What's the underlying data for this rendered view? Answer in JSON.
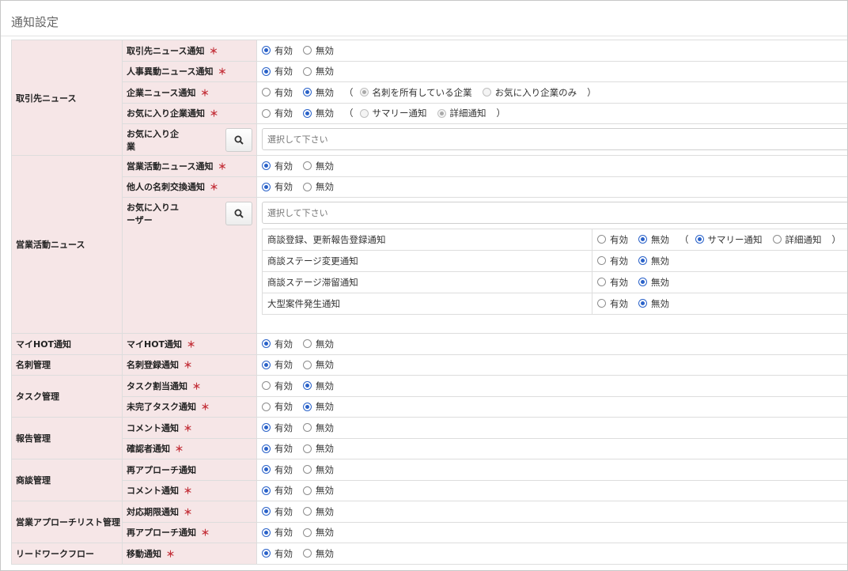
{
  "page": {
    "title": "通知設定"
  },
  "common": {
    "on": "有効",
    "off": "無効",
    "req": "＊",
    "paren_open": "（",
    "paren_close": "）",
    "picker_placeholder": "選択して下さい"
  },
  "groups": [
    {
      "category": "取引先ニュース",
      "rows": [
        {
          "label": "取引先ニュース通知",
          "required": true,
          "value": "on"
        },
        {
          "label": "人事異動ニュース通知",
          "required": true,
          "value": "on"
        },
        {
          "label": "企業ニュース通知",
          "required": true,
          "value": "off",
          "sub": [
            {
              "label": "名刺を所有している企業",
              "selected": true
            },
            {
              "label": "お気に入り企業のみ",
              "selected": false
            }
          ]
        },
        {
          "label": "お気に入り企業通知",
          "required": true,
          "value": "off",
          "sub": [
            {
              "label": "サマリー通知",
              "selected": false
            },
            {
              "label": "詳細通知",
              "selected": true
            }
          ]
        },
        {
          "label": "お気に入り企業",
          "type": "picker"
        }
      ]
    },
    {
      "category": "営業活動ニュース",
      "rows": [
        {
          "label": "営業活動ニュース通知",
          "required": true,
          "value": "on"
        },
        {
          "label": "他人の名刺交換通知",
          "required": true,
          "value": "on"
        },
        {
          "label": "お気に入りユーザー",
          "type": "picker",
          "subtable": [
            {
              "name": "商談登録、更新報告登録通知",
              "value": "off",
              "sub": [
                {
                  "label": "サマリー通知",
                  "selected": true
                },
                {
                  "label": "詳細通知",
                  "selected": false
                }
              ]
            },
            {
              "name": "商談ステージ変更通知",
              "value": "off"
            },
            {
              "name": "商談ステージ滞留通知",
              "value": "off"
            },
            {
              "name": "大型案件発生通知",
              "value": "off"
            }
          ]
        }
      ]
    },
    {
      "category": "マイHOT通知",
      "rows": [
        {
          "label": "マイHOT通知",
          "required": true,
          "value": "on"
        }
      ]
    },
    {
      "category": "名刺管理",
      "rows": [
        {
          "label": "名刺登録通知",
          "required": true,
          "value": "on"
        }
      ]
    },
    {
      "category": "タスク管理",
      "rows": [
        {
          "label": "タスク割当通知",
          "required": true,
          "value": "off"
        },
        {
          "label": "未完了タスク通知",
          "required": true,
          "value": "off"
        }
      ]
    },
    {
      "category": "報告管理",
      "rows": [
        {
          "label": "コメント通知",
          "required": true,
          "value": "on"
        },
        {
          "label": "確認者通知",
          "required": true,
          "value": "on"
        }
      ]
    },
    {
      "category": "商談管理",
      "rows": [
        {
          "label": "再アプローチ通知",
          "required": false,
          "value": "on"
        },
        {
          "label": "コメント通知",
          "required": true,
          "value": "on"
        }
      ]
    },
    {
      "category": "営業アプローチリスト管理",
      "rows": [
        {
          "label": "対応期限通知",
          "required": true,
          "value": "on"
        },
        {
          "label": "再アプローチ通知",
          "required": true,
          "value": "on"
        }
      ]
    },
    {
      "category": "リードワークフロー",
      "rows": [
        {
          "label": "移動通知",
          "required": true,
          "value": "on"
        }
      ]
    }
  ]
}
